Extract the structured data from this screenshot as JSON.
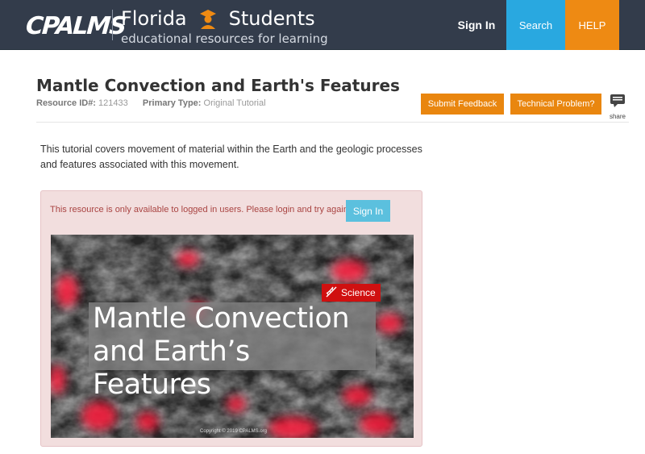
{
  "header": {
    "logo_text": "CPALMS",
    "brand_state": "Florida",
    "brand_audience": "Students",
    "tagline": "educational resources for learning",
    "nav": {
      "signin": "Sign In",
      "search": "Search",
      "help": "HELP"
    },
    "colors": {
      "bar": "#333c4b",
      "search": "#29a8e0",
      "help": "#ee8a13"
    }
  },
  "resource": {
    "title": "Mantle Convection and Earth's Features",
    "id_label": "Resource ID#:",
    "id_value": "121433",
    "type_label": "Primary Type:",
    "type_value": "Original Tutorial",
    "feedback_button": "Submit Feedback",
    "technical_button": "Technical Problem?",
    "share_label": "share",
    "description": "This tutorial covers movement of material within the Earth and the geologic processes and features associated with this movement."
  },
  "alert": {
    "message": "This resource is only available to logged in users. Please login and try again.",
    "signin_button": "Sign In"
  },
  "hero": {
    "badge": "Science",
    "title_line1": "Mantle Convection",
    "title_line2": "and Earth’s Features",
    "copyright": "Copyright © 2019 CPALMS.org"
  }
}
